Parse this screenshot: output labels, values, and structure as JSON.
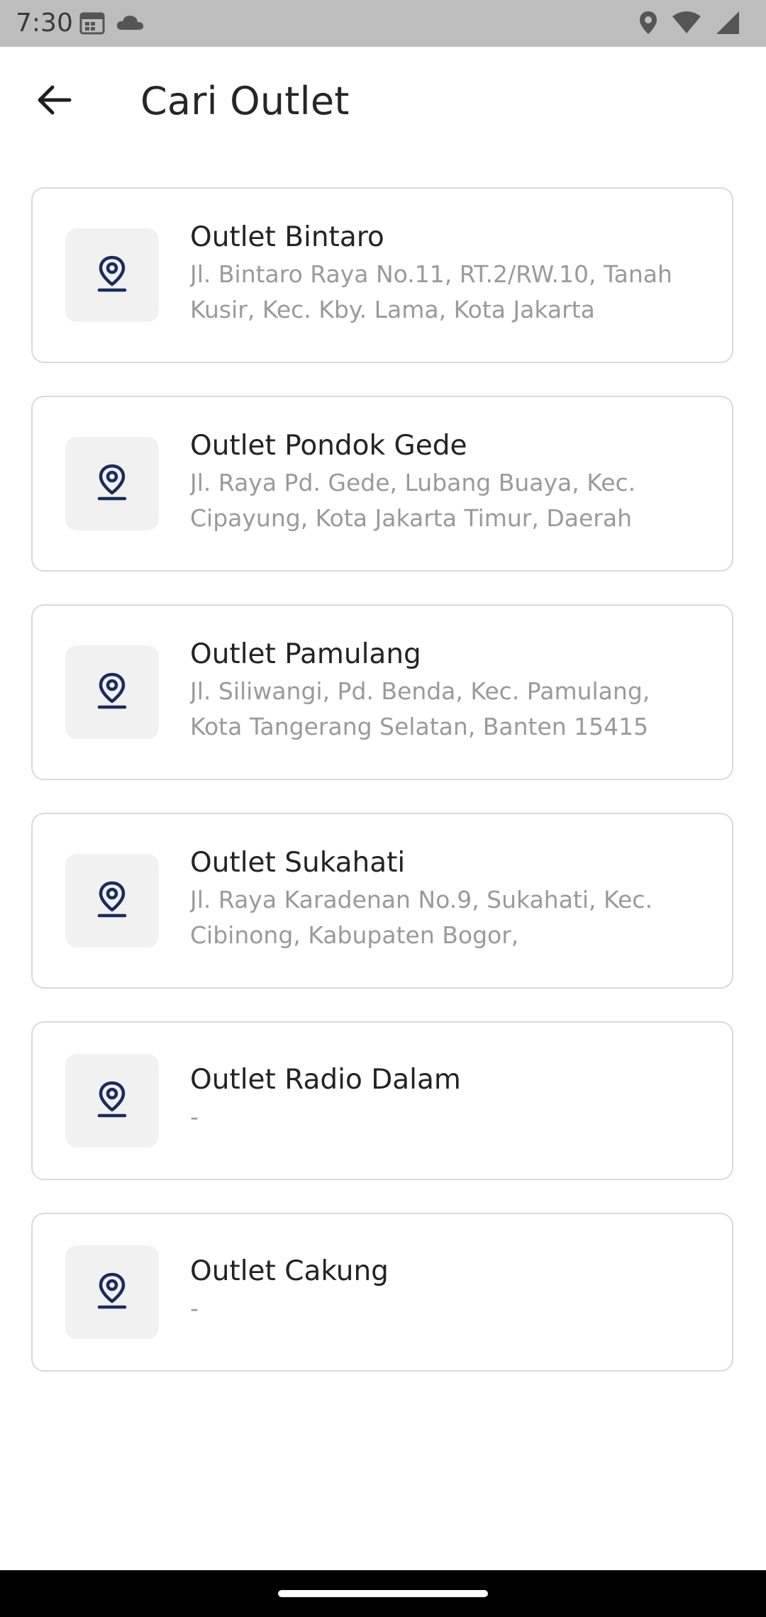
{
  "status_bar": {
    "time": "7:30",
    "left_icons": [
      "calendar-icon",
      "cloud-icon"
    ],
    "right_icons": [
      "location-icon",
      "wifi-icon",
      "signal-icon"
    ]
  },
  "app_bar": {
    "back_icon": "arrow-left-icon",
    "title": "Cari Outlet"
  },
  "colors": {
    "accent": "#1a2b5f",
    "tile_bg": "#f1f1f1",
    "card_border": "#d9d9d9",
    "address_text": "#9a9a9a"
  },
  "outlets": [
    {
      "name": "Outlet Bintaro",
      "address": "Jl. Bintaro Raya No.11, RT.2/RW.10, Tanah Kusir, Kec. Kby. Lama, Kota Jakarta",
      "icon": "map-pin-icon"
    },
    {
      "name": "Outlet Pondok Gede",
      "address": "Jl. Raya Pd. Gede, Lubang Buaya, Kec. Cipayung, Kota Jakarta Timur, Daerah",
      "icon": "map-pin-icon"
    },
    {
      "name": "Outlet Pamulang",
      "address": "Jl. Siliwangi, Pd. Benda, Kec. Pamulang, Kota Tangerang Selatan, Banten 15415",
      "icon": "map-pin-icon"
    },
    {
      "name": "Outlet Sukahati",
      "address": "Jl. Raya Karadenan No.9, Sukahati, Kec. Cibinong, Kabupaten Bogor,",
      "icon": "map-pin-icon"
    },
    {
      "name": "Outlet Radio Dalam",
      "address": "-",
      "icon": "map-pin-icon"
    },
    {
      "name": "Outlet Cakung",
      "address": "-",
      "icon": "map-pin-icon"
    }
  ]
}
